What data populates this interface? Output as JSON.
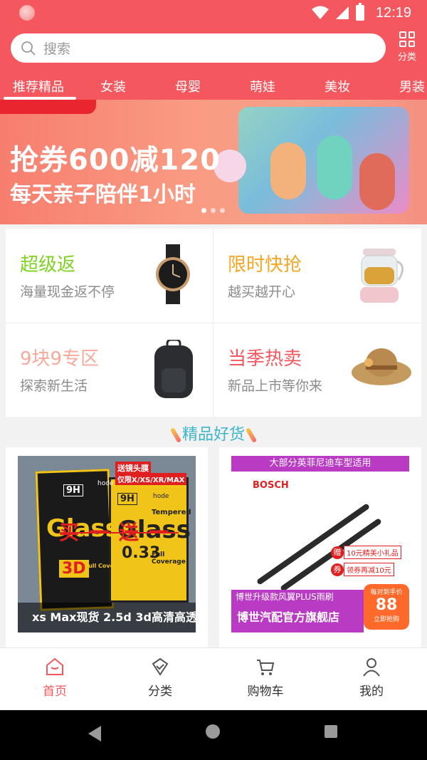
{
  "status": {
    "time": "12:19"
  },
  "search": {
    "placeholder": "搜索"
  },
  "category_button": {
    "label": "分类"
  },
  "tabs": [
    "推荐精品",
    "女装",
    "母婴",
    "萌娃",
    "美妆",
    "男装"
  ],
  "banner": {
    "line1": "抢券600减120",
    "line2": "每天亲子陪伴1小时",
    "dots": 3,
    "active_dot": 0
  },
  "features": [
    {
      "title": "超级返",
      "subtitle": "海量现金返不停",
      "color": "#7ed321",
      "icon": "watch-icon"
    },
    {
      "title": "限时快抢",
      "subtitle": "越买越开心",
      "color": "#f5a623",
      "icon": "teapot-icon"
    },
    {
      "title": "9块9专区",
      "subtitle": "探索新生活",
      "color": "#f7a99b",
      "icon": "backpack-icon"
    },
    {
      "title": "当季热卖",
      "subtitle": "新品上市等你来",
      "color": "#f4575d",
      "icon": "sunhat-icon"
    }
  ],
  "section": {
    "title": "精品好货"
  },
  "products": [
    {
      "caption": "xs Max现货 2.5d 3d高清高透",
      "img_text": {
        "badge": "送镜头膜",
        "models": "仅限X/XS/XR/MAX",
        "nine_h": "9H",
        "brand": "hode",
        "glass": "Glass",
        "promo": "买一送一",
        "thickness": "0.33",
        "coverage": "Full Coverage",
        "label_3d": "3D",
        "tempered": "Tempered"
      }
    },
    {
      "caption": "博世汽配官方旗舰店",
      "img_text": {
        "top_banner": "大部分英菲尼迪车型适用",
        "brand": "BOSCH",
        "gift_tag": "赠",
        "gift": "10元精美小礼品",
        "coupon_tag": "券",
        "coupon": "领券再减10元",
        "upgrade": "博世升级款风翼PLUS雨刷",
        "price_label": "每对到手价",
        "price": "88",
        "cta": "立即抢购"
      }
    }
  ],
  "bottom_nav": [
    {
      "label": "首页",
      "active": true,
      "icon": "home-icon"
    },
    {
      "label": "分类",
      "active": false,
      "icon": "category-icon"
    },
    {
      "label": "购物车",
      "active": false,
      "icon": "cart-icon"
    },
    {
      "label": "我的",
      "active": false,
      "icon": "user-icon"
    }
  ]
}
